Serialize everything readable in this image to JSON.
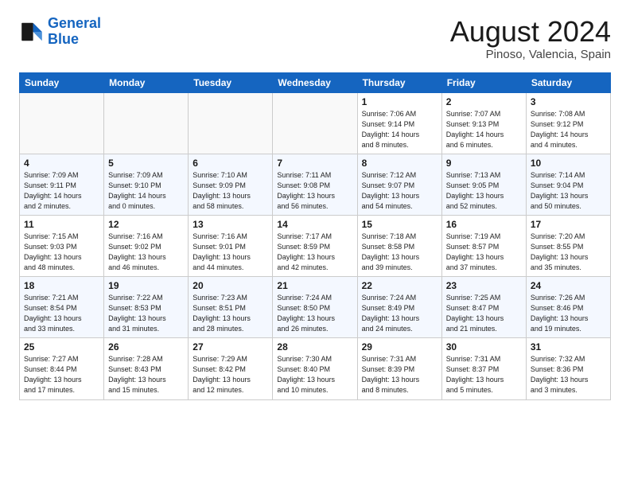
{
  "logo": {
    "line1": "General",
    "line2": "Blue"
  },
  "title": "August 2024",
  "subtitle": "Pinoso, Valencia, Spain",
  "weekdays": [
    "Sunday",
    "Monday",
    "Tuesday",
    "Wednesday",
    "Thursday",
    "Friday",
    "Saturday"
  ],
  "weeks": [
    [
      {
        "day": "",
        "info": ""
      },
      {
        "day": "",
        "info": ""
      },
      {
        "day": "",
        "info": ""
      },
      {
        "day": "",
        "info": ""
      },
      {
        "day": "1",
        "info": "Sunrise: 7:06 AM\nSunset: 9:14 PM\nDaylight: 14 hours\nand 8 minutes."
      },
      {
        "day": "2",
        "info": "Sunrise: 7:07 AM\nSunset: 9:13 PM\nDaylight: 14 hours\nand 6 minutes."
      },
      {
        "day": "3",
        "info": "Sunrise: 7:08 AM\nSunset: 9:12 PM\nDaylight: 14 hours\nand 4 minutes."
      }
    ],
    [
      {
        "day": "4",
        "info": "Sunrise: 7:09 AM\nSunset: 9:11 PM\nDaylight: 14 hours\nand 2 minutes."
      },
      {
        "day": "5",
        "info": "Sunrise: 7:09 AM\nSunset: 9:10 PM\nDaylight: 14 hours\nand 0 minutes."
      },
      {
        "day": "6",
        "info": "Sunrise: 7:10 AM\nSunset: 9:09 PM\nDaylight: 13 hours\nand 58 minutes."
      },
      {
        "day": "7",
        "info": "Sunrise: 7:11 AM\nSunset: 9:08 PM\nDaylight: 13 hours\nand 56 minutes."
      },
      {
        "day": "8",
        "info": "Sunrise: 7:12 AM\nSunset: 9:07 PM\nDaylight: 13 hours\nand 54 minutes."
      },
      {
        "day": "9",
        "info": "Sunrise: 7:13 AM\nSunset: 9:05 PM\nDaylight: 13 hours\nand 52 minutes."
      },
      {
        "day": "10",
        "info": "Sunrise: 7:14 AM\nSunset: 9:04 PM\nDaylight: 13 hours\nand 50 minutes."
      }
    ],
    [
      {
        "day": "11",
        "info": "Sunrise: 7:15 AM\nSunset: 9:03 PM\nDaylight: 13 hours\nand 48 minutes."
      },
      {
        "day": "12",
        "info": "Sunrise: 7:16 AM\nSunset: 9:02 PM\nDaylight: 13 hours\nand 46 minutes."
      },
      {
        "day": "13",
        "info": "Sunrise: 7:16 AM\nSunset: 9:01 PM\nDaylight: 13 hours\nand 44 minutes."
      },
      {
        "day": "14",
        "info": "Sunrise: 7:17 AM\nSunset: 8:59 PM\nDaylight: 13 hours\nand 42 minutes."
      },
      {
        "day": "15",
        "info": "Sunrise: 7:18 AM\nSunset: 8:58 PM\nDaylight: 13 hours\nand 39 minutes."
      },
      {
        "day": "16",
        "info": "Sunrise: 7:19 AM\nSunset: 8:57 PM\nDaylight: 13 hours\nand 37 minutes."
      },
      {
        "day": "17",
        "info": "Sunrise: 7:20 AM\nSunset: 8:55 PM\nDaylight: 13 hours\nand 35 minutes."
      }
    ],
    [
      {
        "day": "18",
        "info": "Sunrise: 7:21 AM\nSunset: 8:54 PM\nDaylight: 13 hours\nand 33 minutes."
      },
      {
        "day": "19",
        "info": "Sunrise: 7:22 AM\nSunset: 8:53 PM\nDaylight: 13 hours\nand 31 minutes."
      },
      {
        "day": "20",
        "info": "Sunrise: 7:23 AM\nSunset: 8:51 PM\nDaylight: 13 hours\nand 28 minutes."
      },
      {
        "day": "21",
        "info": "Sunrise: 7:24 AM\nSunset: 8:50 PM\nDaylight: 13 hours\nand 26 minutes."
      },
      {
        "day": "22",
        "info": "Sunrise: 7:24 AM\nSunset: 8:49 PM\nDaylight: 13 hours\nand 24 minutes."
      },
      {
        "day": "23",
        "info": "Sunrise: 7:25 AM\nSunset: 8:47 PM\nDaylight: 13 hours\nand 21 minutes."
      },
      {
        "day": "24",
        "info": "Sunrise: 7:26 AM\nSunset: 8:46 PM\nDaylight: 13 hours\nand 19 minutes."
      }
    ],
    [
      {
        "day": "25",
        "info": "Sunrise: 7:27 AM\nSunset: 8:44 PM\nDaylight: 13 hours\nand 17 minutes."
      },
      {
        "day": "26",
        "info": "Sunrise: 7:28 AM\nSunset: 8:43 PM\nDaylight: 13 hours\nand 15 minutes."
      },
      {
        "day": "27",
        "info": "Sunrise: 7:29 AM\nSunset: 8:42 PM\nDaylight: 13 hours\nand 12 minutes."
      },
      {
        "day": "28",
        "info": "Sunrise: 7:30 AM\nSunset: 8:40 PM\nDaylight: 13 hours\nand 10 minutes."
      },
      {
        "day": "29",
        "info": "Sunrise: 7:31 AM\nSunset: 8:39 PM\nDaylight: 13 hours\nand 8 minutes."
      },
      {
        "day": "30",
        "info": "Sunrise: 7:31 AM\nSunset: 8:37 PM\nDaylight: 13 hours\nand 5 minutes."
      },
      {
        "day": "31",
        "info": "Sunrise: 7:32 AM\nSunset: 8:36 PM\nDaylight: 13 hours\nand 3 minutes."
      }
    ]
  ]
}
